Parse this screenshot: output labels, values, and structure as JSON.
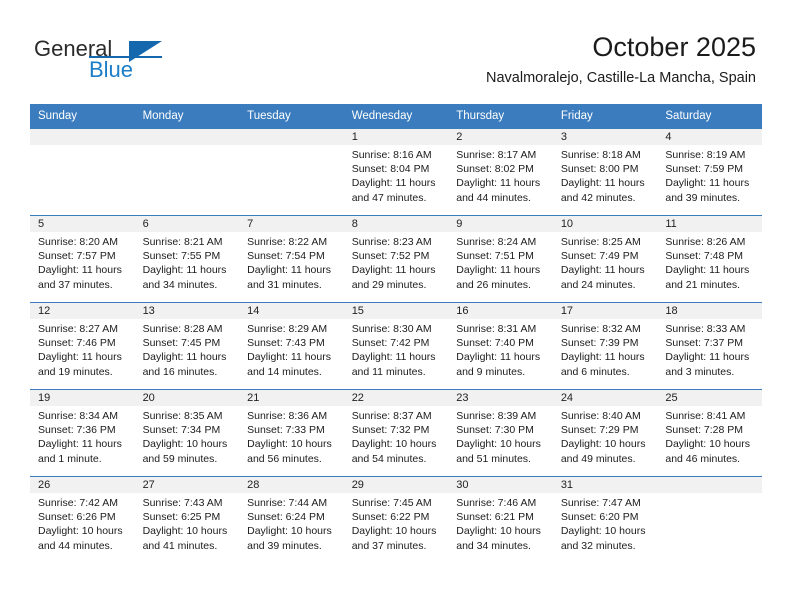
{
  "brand": {
    "name_part1": "General",
    "name_part2": "Blue",
    "logo_icon": "triangle-logo-icon"
  },
  "header": {
    "month_title": "October 2025",
    "location": "Navalmoralejo, Castille-La Mancha, Spain"
  },
  "colors": {
    "header_blue": "#3a7cbe",
    "brand_blue": "#1a7ec8",
    "daynum_band": "#f1f1f1",
    "text": "#1c1c1c"
  },
  "weekday_headers": [
    "Sunday",
    "Monday",
    "Tuesday",
    "Wednesday",
    "Thursday",
    "Friday",
    "Saturday"
  ],
  "labels": {
    "sunrise_prefix": "Sunrise:",
    "sunset_prefix": "Sunset:",
    "daylight_prefix": "Daylight:"
  },
  "weeks": [
    [
      {
        "empty": true,
        "day": "",
        "sunrise": "",
        "sunset": "",
        "daylight_line1": "",
        "daylight_line2": ""
      },
      {
        "empty": true,
        "day": "",
        "sunrise": "",
        "sunset": "",
        "daylight_line1": "",
        "daylight_line2": ""
      },
      {
        "empty": true,
        "day": "",
        "sunrise": "",
        "sunset": "",
        "daylight_line1": "",
        "daylight_line2": ""
      },
      {
        "empty": false,
        "day": "1",
        "sunrise": "Sunrise: 8:16 AM",
        "sunset": "Sunset: 8:04 PM",
        "daylight_line1": "Daylight: 11 hours",
        "daylight_line2": "and 47 minutes."
      },
      {
        "empty": false,
        "day": "2",
        "sunrise": "Sunrise: 8:17 AM",
        "sunset": "Sunset: 8:02 PM",
        "daylight_line1": "Daylight: 11 hours",
        "daylight_line2": "and 44 minutes."
      },
      {
        "empty": false,
        "day": "3",
        "sunrise": "Sunrise: 8:18 AM",
        "sunset": "Sunset: 8:00 PM",
        "daylight_line1": "Daylight: 11 hours",
        "daylight_line2": "and 42 minutes."
      },
      {
        "empty": false,
        "day": "4",
        "sunrise": "Sunrise: 8:19 AM",
        "sunset": "Sunset: 7:59 PM",
        "daylight_line1": "Daylight: 11 hours",
        "daylight_line2": "and 39 minutes."
      }
    ],
    [
      {
        "empty": false,
        "day": "5",
        "sunrise": "Sunrise: 8:20 AM",
        "sunset": "Sunset: 7:57 PM",
        "daylight_line1": "Daylight: 11 hours",
        "daylight_line2": "and 37 minutes."
      },
      {
        "empty": false,
        "day": "6",
        "sunrise": "Sunrise: 8:21 AM",
        "sunset": "Sunset: 7:55 PM",
        "daylight_line1": "Daylight: 11 hours",
        "daylight_line2": "and 34 minutes."
      },
      {
        "empty": false,
        "day": "7",
        "sunrise": "Sunrise: 8:22 AM",
        "sunset": "Sunset: 7:54 PM",
        "daylight_line1": "Daylight: 11 hours",
        "daylight_line2": "and 31 minutes."
      },
      {
        "empty": false,
        "day": "8",
        "sunrise": "Sunrise: 8:23 AM",
        "sunset": "Sunset: 7:52 PM",
        "daylight_line1": "Daylight: 11 hours",
        "daylight_line2": "and 29 minutes."
      },
      {
        "empty": false,
        "day": "9",
        "sunrise": "Sunrise: 8:24 AM",
        "sunset": "Sunset: 7:51 PM",
        "daylight_line1": "Daylight: 11 hours",
        "daylight_line2": "and 26 minutes."
      },
      {
        "empty": false,
        "day": "10",
        "sunrise": "Sunrise: 8:25 AM",
        "sunset": "Sunset: 7:49 PM",
        "daylight_line1": "Daylight: 11 hours",
        "daylight_line2": "and 24 minutes."
      },
      {
        "empty": false,
        "day": "11",
        "sunrise": "Sunrise: 8:26 AM",
        "sunset": "Sunset: 7:48 PM",
        "daylight_line1": "Daylight: 11 hours",
        "daylight_line2": "and 21 minutes."
      }
    ],
    [
      {
        "empty": false,
        "day": "12",
        "sunrise": "Sunrise: 8:27 AM",
        "sunset": "Sunset: 7:46 PM",
        "daylight_line1": "Daylight: 11 hours",
        "daylight_line2": "and 19 minutes."
      },
      {
        "empty": false,
        "day": "13",
        "sunrise": "Sunrise: 8:28 AM",
        "sunset": "Sunset: 7:45 PM",
        "daylight_line1": "Daylight: 11 hours",
        "daylight_line2": "and 16 minutes."
      },
      {
        "empty": false,
        "day": "14",
        "sunrise": "Sunrise: 8:29 AM",
        "sunset": "Sunset: 7:43 PM",
        "daylight_line1": "Daylight: 11 hours",
        "daylight_line2": "and 14 minutes."
      },
      {
        "empty": false,
        "day": "15",
        "sunrise": "Sunrise: 8:30 AM",
        "sunset": "Sunset: 7:42 PM",
        "daylight_line1": "Daylight: 11 hours",
        "daylight_line2": "and 11 minutes."
      },
      {
        "empty": false,
        "day": "16",
        "sunrise": "Sunrise: 8:31 AM",
        "sunset": "Sunset: 7:40 PM",
        "daylight_line1": "Daylight: 11 hours",
        "daylight_line2": "and 9 minutes."
      },
      {
        "empty": false,
        "day": "17",
        "sunrise": "Sunrise: 8:32 AM",
        "sunset": "Sunset: 7:39 PM",
        "daylight_line1": "Daylight: 11 hours",
        "daylight_line2": "and 6 minutes."
      },
      {
        "empty": false,
        "day": "18",
        "sunrise": "Sunrise: 8:33 AM",
        "sunset": "Sunset: 7:37 PM",
        "daylight_line1": "Daylight: 11 hours",
        "daylight_line2": "and 3 minutes."
      }
    ],
    [
      {
        "empty": false,
        "day": "19",
        "sunrise": "Sunrise: 8:34 AM",
        "sunset": "Sunset: 7:36 PM",
        "daylight_line1": "Daylight: 11 hours",
        "daylight_line2": "and 1 minute."
      },
      {
        "empty": false,
        "day": "20",
        "sunrise": "Sunrise: 8:35 AM",
        "sunset": "Sunset: 7:34 PM",
        "daylight_line1": "Daylight: 10 hours",
        "daylight_line2": "and 59 minutes."
      },
      {
        "empty": false,
        "day": "21",
        "sunrise": "Sunrise: 8:36 AM",
        "sunset": "Sunset: 7:33 PM",
        "daylight_line1": "Daylight: 10 hours",
        "daylight_line2": "and 56 minutes."
      },
      {
        "empty": false,
        "day": "22",
        "sunrise": "Sunrise: 8:37 AM",
        "sunset": "Sunset: 7:32 PM",
        "daylight_line1": "Daylight: 10 hours",
        "daylight_line2": "and 54 minutes."
      },
      {
        "empty": false,
        "day": "23",
        "sunrise": "Sunrise: 8:39 AM",
        "sunset": "Sunset: 7:30 PM",
        "daylight_line1": "Daylight: 10 hours",
        "daylight_line2": "and 51 minutes."
      },
      {
        "empty": false,
        "day": "24",
        "sunrise": "Sunrise: 8:40 AM",
        "sunset": "Sunset: 7:29 PM",
        "daylight_line1": "Daylight: 10 hours",
        "daylight_line2": "and 49 minutes."
      },
      {
        "empty": false,
        "day": "25",
        "sunrise": "Sunrise: 8:41 AM",
        "sunset": "Sunset: 7:28 PM",
        "daylight_line1": "Daylight: 10 hours",
        "daylight_line2": "and 46 minutes."
      }
    ],
    [
      {
        "empty": false,
        "day": "26",
        "sunrise": "Sunrise: 7:42 AM",
        "sunset": "Sunset: 6:26 PM",
        "daylight_line1": "Daylight: 10 hours",
        "daylight_line2": "and 44 minutes."
      },
      {
        "empty": false,
        "day": "27",
        "sunrise": "Sunrise: 7:43 AM",
        "sunset": "Sunset: 6:25 PM",
        "daylight_line1": "Daylight: 10 hours",
        "daylight_line2": "and 41 minutes."
      },
      {
        "empty": false,
        "day": "28",
        "sunrise": "Sunrise: 7:44 AM",
        "sunset": "Sunset: 6:24 PM",
        "daylight_line1": "Daylight: 10 hours",
        "daylight_line2": "and 39 minutes."
      },
      {
        "empty": false,
        "day": "29",
        "sunrise": "Sunrise: 7:45 AM",
        "sunset": "Sunset: 6:22 PM",
        "daylight_line1": "Daylight: 10 hours",
        "daylight_line2": "and 37 minutes."
      },
      {
        "empty": false,
        "day": "30",
        "sunrise": "Sunrise: 7:46 AM",
        "sunset": "Sunset: 6:21 PM",
        "daylight_line1": "Daylight: 10 hours",
        "daylight_line2": "and 34 minutes."
      },
      {
        "empty": false,
        "day": "31",
        "sunrise": "Sunrise: 7:47 AM",
        "sunset": "Sunset: 6:20 PM",
        "daylight_line1": "Daylight: 10 hours",
        "daylight_line2": "and 32 minutes."
      },
      {
        "empty": true,
        "day": "",
        "sunrise": "",
        "sunset": "",
        "daylight_line1": "",
        "daylight_line2": ""
      }
    ]
  ]
}
